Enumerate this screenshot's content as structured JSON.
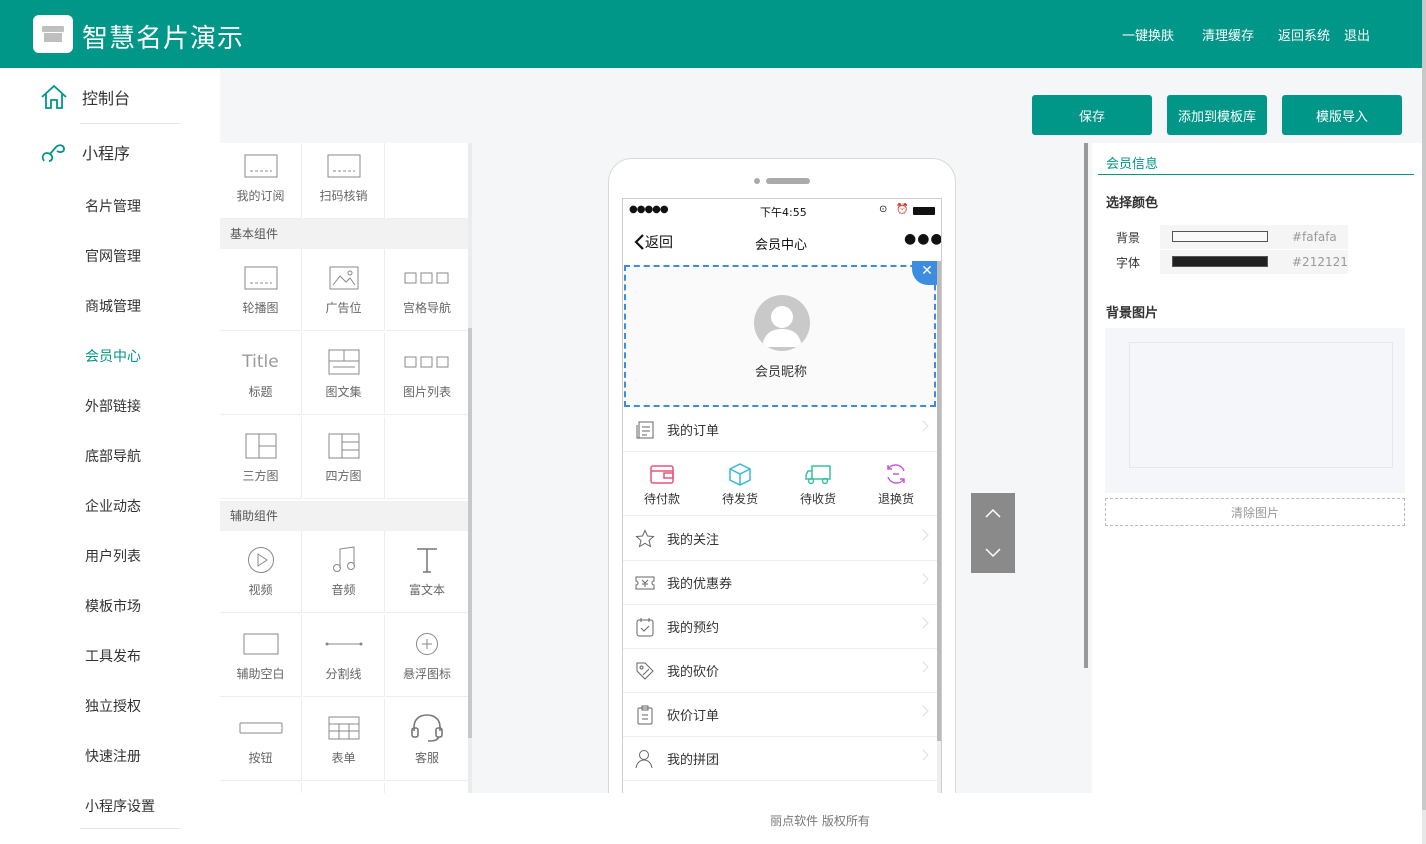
{
  "header": {
    "brand": "智慧名片演示",
    "nav": [
      "一键换肤",
      "清理缓存",
      "返回系统",
      "退出"
    ],
    "bg_color": "#009688"
  },
  "sidebar": {
    "main_items": [
      {
        "label": "控制台",
        "icon": "home-icon"
      },
      {
        "label": "小程序",
        "icon": "miniprogram-icon"
      }
    ],
    "sub_items": [
      {
        "label": "名片管理"
      },
      {
        "label": "官网管理"
      },
      {
        "label": "商城管理"
      },
      {
        "label": "会员中心",
        "active": true
      },
      {
        "label": "外部链接"
      },
      {
        "label": "底部导航"
      },
      {
        "label": "企业动态"
      },
      {
        "label": "用户列表"
      },
      {
        "label": "模板市场"
      },
      {
        "label": "工具发布"
      },
      {
        "label": "独立授权"
      },
      {
        "label": "快速注册"
      },
      {
        "label": "小程序设置"
      }
    ]
  },
  "actions": {
    "save": "保存",
    "add_to_template": "添加到模板库",
    "import_template": "模版导入"
  },
  "palette": {
    "top_items": [
      {
        "label": "我的订阅",
        "icon": "placeholder-icon"
      },
      {
        "label": "扫码核销",
        "icon": "placeholder-icon"
      }
    ],
    "basic_header": "基本组件",
    "basic_items": [
      {
        "label": "轮播图",
        "icon": "carousel-icon"
      },
      {
        "label": "广告位",
        "icon": "image-icon"
      },
      {
        "label": "宫格导航",
        "icon": "grid-nav-icon"
      },
      {
        "label": "标题",
        "icon": "title-icon",
        "icon_text": "Title"
      },
      {
        "label": "图文集",
        "icon": "article-set-icon"
      },
      {
        "label": "图片列表",
        "icon": "image-list-icon"
      },
      {
        "label": "三方图",
        "icon": "three-grid-icon"
      },
      {
        "label": "四方图",
        "icon": "four-grid-icon"
      }
    ],
    "aux_header": "辅助组件",
    "aux_items": [
      {
        "label": "视频",
        "icon": "play-icon"
      },
      {
        "label": "音频",
        "icon": "music-icon"
      },
      {
        "label": "富文本",
        "icon": "text-icon"
      },
      {
        "label": "辅助空白",
        "icon": "blank-icon"
      },
      {
        "label": "分割线",
        "icon": "divider-icon"
      },
      {
        "label": "悬浮图标",
        "icon": "plus-circle-icon"
      },
      {
        "label": "按钮",
        "icon": "button-icon"
      },
      {
        "label": "表单",
        "icon": "form-icon"
      },
      {
        "label": "客服",
        "icon": "headset-icon"
      }
    ]
  },
  "phone": {
    "status_time": "下午4:55",
    "back_label": "返回",
    "page_title": "会员中心",
    "nickname": "会员昵称",
    "my_orders": "我的订单",
    "order_icons": [
      {
        "label": "待付款",
        "icon": "wallet-icon",
        "color": "#e8557a"
      },
      {
        "label": "待发货",
        "icon": "box-icon",
        "color": "#39b8d8"
      },
      {
        "label": "待收货",
        "icon": "truck-icon",
        "color": "#3cbfa0"
      },
      {
        "label": "退换货",
        "icon": "refresh-icon",
        "color": "#c05bd6"
      }
    ],
    "menu_items": [
      {
        "label": "我的关注",
        "icon": "star-icon"
      },
      {
        "label": "我的优惠券",
        "icon": "coupon-icon"
      },
      {
        "label": "我的预约",
        "icon": "calendar-icon"
      },
      {
        "label": "我的砍价",
        "icon": "tag-icon"
      },
      {
        "label": "砍价订单",
        "icon": "clipboard-icon"
      },
      {
        "label": "我的拼团",
        "icon": "user-icon"
      }
    ]
  },
  "right_panel": {
    "tab": "会员信息",
    "select_color": "选择颜色",
    "bg_label": "背景",
    "font_label": "字体",
    "bg_color": "#fafafa",
    "font_color": "#212121",
    "bg_image_title": "背景图片",
    "clear_image": "清除图片"
  },
  "footer": "丽点软件 版权所有"
}
